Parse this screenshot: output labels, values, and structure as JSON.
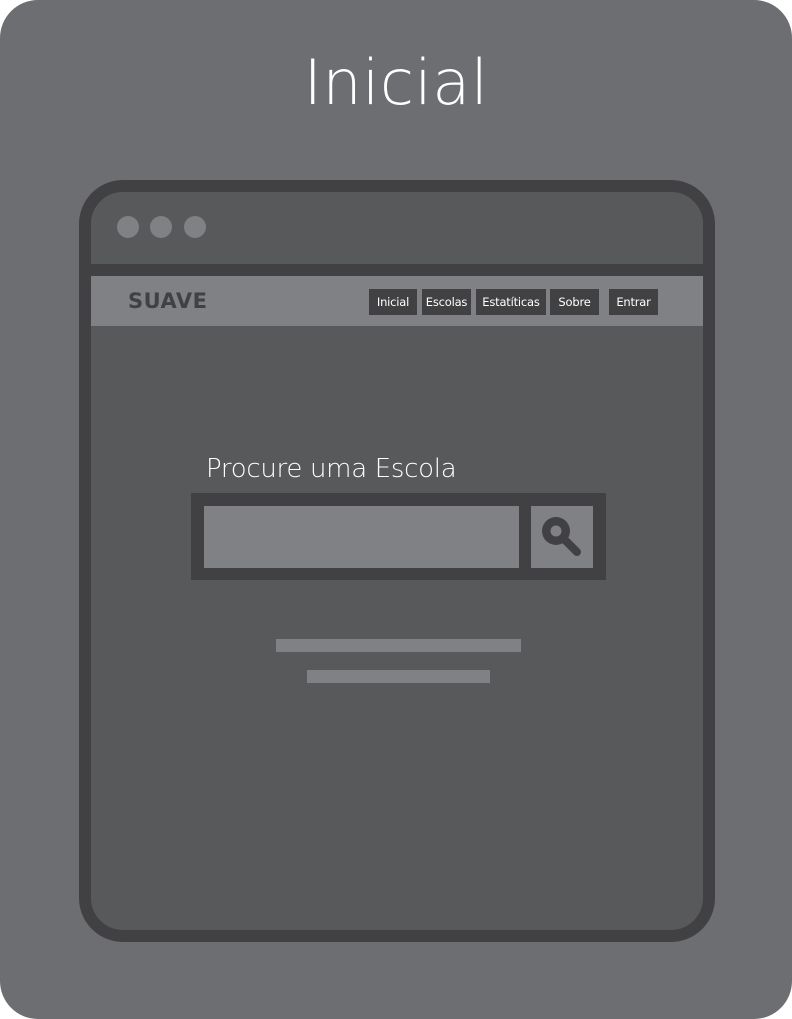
{
  "page": {
    "title": "Inicial"
  },
  "browser": {
    "window_controls": [
      "dot",
      "dot",
      "dot"
    ]
  },
  "navbar": {
    "logo": "SUAVE",
    "items": [
      {
        "label": "Inicial"
      },
      {
        "label": "Escolas"
      },
      {
        "label": "Estatíticas"
      },
      {
        "label": "Sobre"
      },
      {
        "label": "Entrar"
      }
    ]
  },
  "main": {
    "search_heading": "Procure uma Escola",
    "search": {
      "value": "",
      "icon": "search-icon"
    },
    "placeholder_lines": 2
  },
  "colors": {
    "background": "#6d6e71",
    "browser_frame": "#414042",
    "browser_body": "#58595b",
    "light_gray": "#808184",
    "text_light": "#ffffff"
  }
}
